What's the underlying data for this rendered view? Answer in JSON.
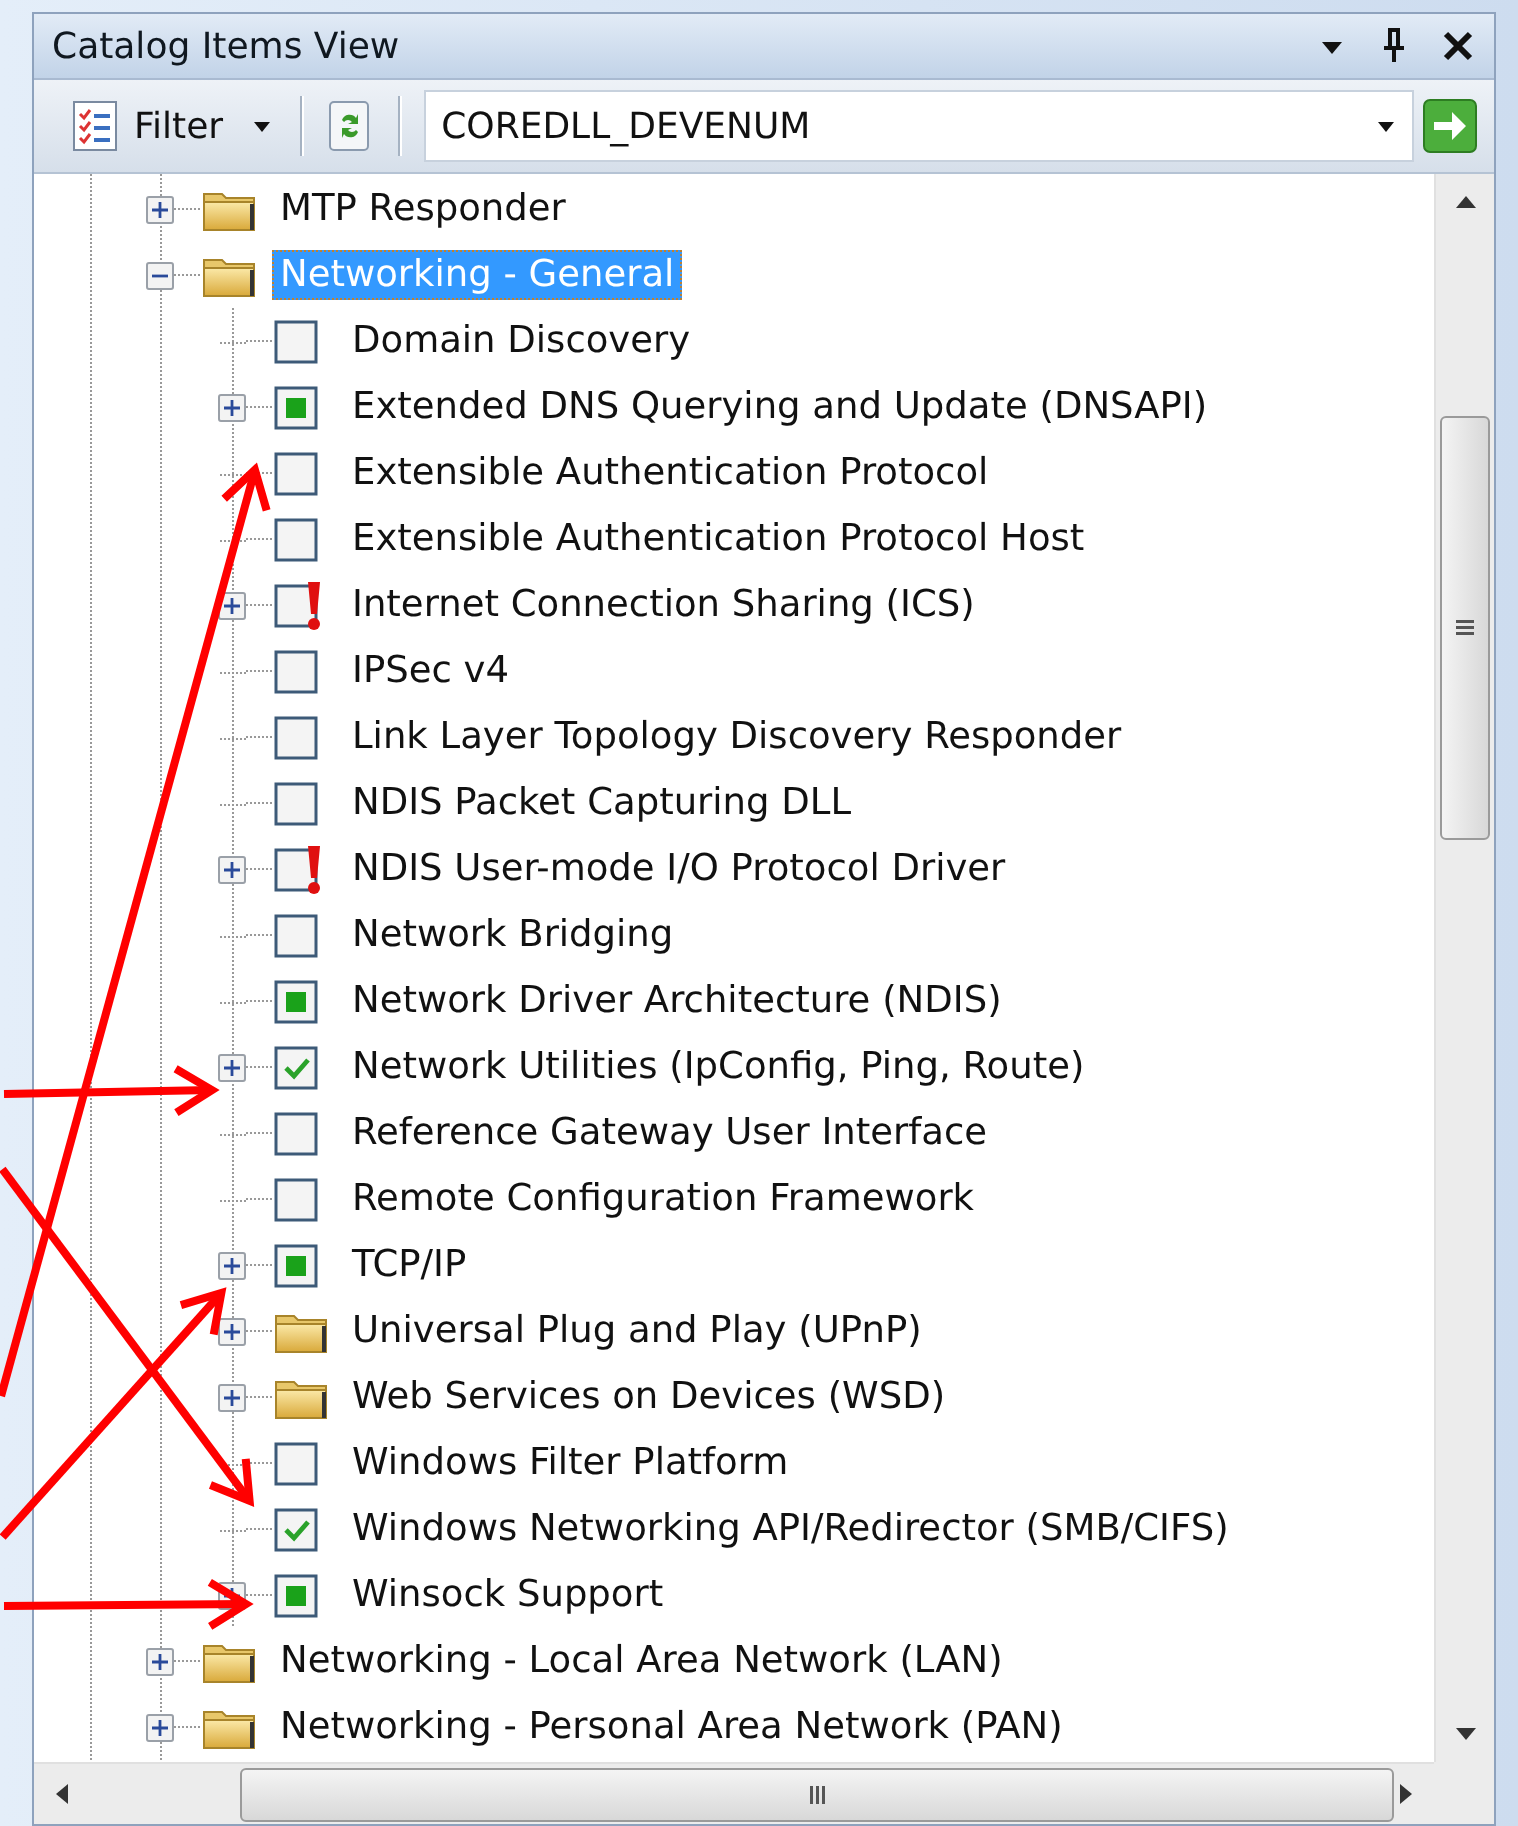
{
  "window": {
    "title": "Catalog Items View"
  },
  "toolbar": {
    "filter_label": "Filter",
    "configuration": {
      "value": "COREDLL_DEVENUM"
    }
  },
  "tree": [
    {
      "label": "MTP Responder",
      "kind": "folder",
      "expandable": true,
      "expanded": false,
      "selected": false
    },
    {
      "label": "Networking - General",
      "kind": "folder",
      "expandable": true,
      "expanded": true,
      "selected": true,
      "children": [
        {
          "label": "Domain Discovery",
          "kind": "item",
          "expandable": false,
          "checked": false,
          "filled": false,
          "warning": false,
          "selected": false
        },
        {
          "label": "Extended DNS Querying and Update (DNSAPI)",
          "kind": "item",
          "expandable": true,
          "checked": false,
          "filled": true,
          "warning": false,
          "selected": false
        },
        {
          "label": "Extensible Authentication Protocol",
          "kind": "item",
          "expandable": false,
          "checked": false,
          "filled": false,
          "warning": false,
          "selected": false
        },
        {
          "label": "Extensible Authentication Protocol Host",
          "kind": "item",
          "expandable": false,
          "checked": false,
          "filled": false,
          "warning": false,
          "selected": false
        },
        {
          "label": "Internet Connection Sharing (ICS)",
          "kind": "item",
          "expandable": true,
          "checked": false,
          "filled": false,
          "warning": true,
          "selected": false
        },
        {
          "label": "IPSec v4",
          "kind": "item",
          "expandable": false,
          "checked": false,
          "filled": false,
          "warning": false,
          "selected": false
        },
        {
          "label": "Link Layer Topology Discovery Responder",
          "kind": "item",
          "expandable": false,
          "checked": false,
          "filled": false,
          "warning": false,
          "selected": false
        },
        {
          "label": "NDIS Packet Capturing DLL",
          "kind": "item",
          "expandable": false,
          "checked": false,
          "filled": false,
          "warning": false,
          "selected": false
        },
        {
          "label": "NDIS User-mode I/O Protocol Driver",
          "kind": "item",
          "expandable": true,
          "checked": false,
          "filled": false,
          "warning": true,
          "selected": false
        },
        {
          "label": "Network Bridging",
          "kind": "item",
          "expandable": false,
          "checked": false,
          "filled": false,
          "warning": false,
          "selected": false
        },
        {
          "label": "Network Driver Architecture (NDIS)",
          "kind": "item",
          "expandable": false,
          "checked": false,
          "filled": true,
          "warning": false,
          "selected": false
        },
        {
          "label": "Network Utilities (IpConfig, Ping, Route)",
          "kind": "item",
          "expandable": true,
          "checked": true,
          "filled": false,
          "warning": false,
          "selected": false
        },
        {
          "label": "Reference Gateway User Interface",
          "kind": "item",
          "expandable": false,
          "checked": false,
          "filled": false,
          "warning": false,
          "selected": false
        },
        {
          "label": "Remote Configuration Framework",
          "kind": "item",
          "expandable": false,
          "checked": false,
          "filled": false,
          "warning": false,
          "selected": false
        },
        {
          "label": "TCP/IP",
          "kind": "item",
          "expandable": true,
          "checked": false,
          "filled": true,
          "warning": false,
          "selected": false
        },
        {
          "label": "Universal Plug and Play (UPnP)",
          "kind": "folder",
          "expandable": true,
          "expanded": false,
          "selected": false
        },
        {
          "label": "Web Services on Devices (WSD)",
          "kind": "folder",
          "expandable": true,
          "expanded": false,
          "selected": false
        },
        {
          "label": "Windows Filter Platform",
          "kind": "item",
          "expandable": false,
          "checked": false,
          "filled": false,
          "warning": false,
          "selected": false
        },
        {
          "label": "Windows Networking API/Redirector (SMB/CIFS)",
          "kind": "item",
          "expandable": false,
          "checked": true,
          "filled": false,
          "warning": false,
          "selected": false
        },
        {
          "label": "Winsock Support",
          "kind": "item",
          "expandable": true,
          "checked": false,
          "filled": true,
          "warning": false,
          "selected": false
        }
      ]
    },
    {
      "label": "Networking - Local Area Network (LAN)",
      "kind": "folder",
      "expandable": true,
      "expanded": false,
      "selected": false
    },
    {
      "label": "Networking - Personal Area Network (PAN)",
      "kind": "folder",
      "expandable": true,
      "expanded": false,
      "selected": false
    }
  ]
}
